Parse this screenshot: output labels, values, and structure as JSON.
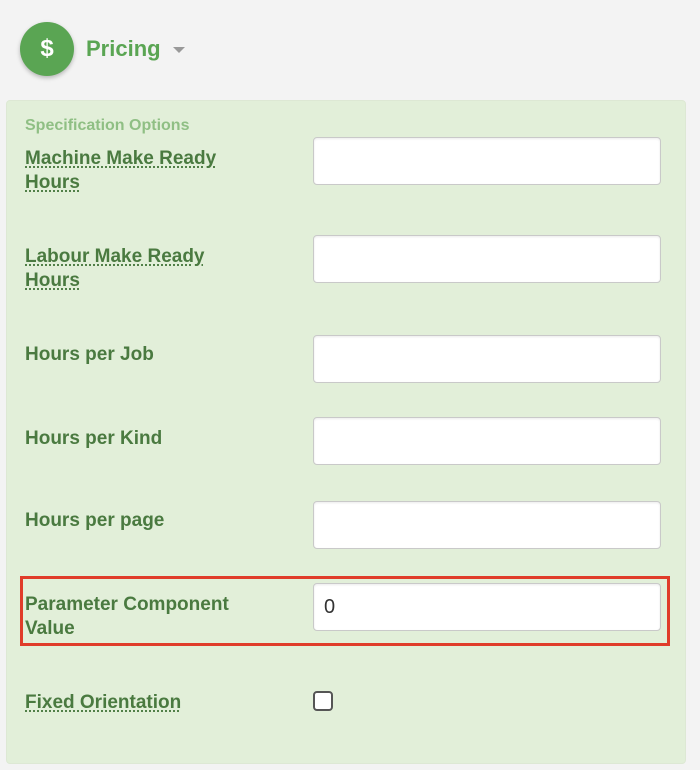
{
  "header": {
    "icon_symbol": "$",
    "title": "Pricing"
  },
  "panel": {
    "section_label": "Specification Options",
    "machine_make_ready": {
      "label": "Machine Make Ready Hours",
      "value": ""
    },
    "labour_make_ready": {
      "label": "Labour Make Ready Hours",
      "value": ""
    },
    "hours_per_job": {
      "label": "Hours per Job",
      "value": ""
    },
    "hours_per_kind": {
      "label": "Hours per Kind",
      "value": ""
    },
    "hours_per_page": {
      "label": "Hours per page",
      "value": ""
    },
    "parameter_component": {
      "label": "Parameter Component Value",
      "value": "0"
    },
    "fixed_orientation": {
      "label": "Fixed Orientation",
      "checked": false
    }
  },
  "colors": {
    "accent_green": "#5aa553",
    "label_green": "#4a7a40",
    "panel_bg": "#e2efd9",
    "highlight_red": "#e03c2a"
  }
}
